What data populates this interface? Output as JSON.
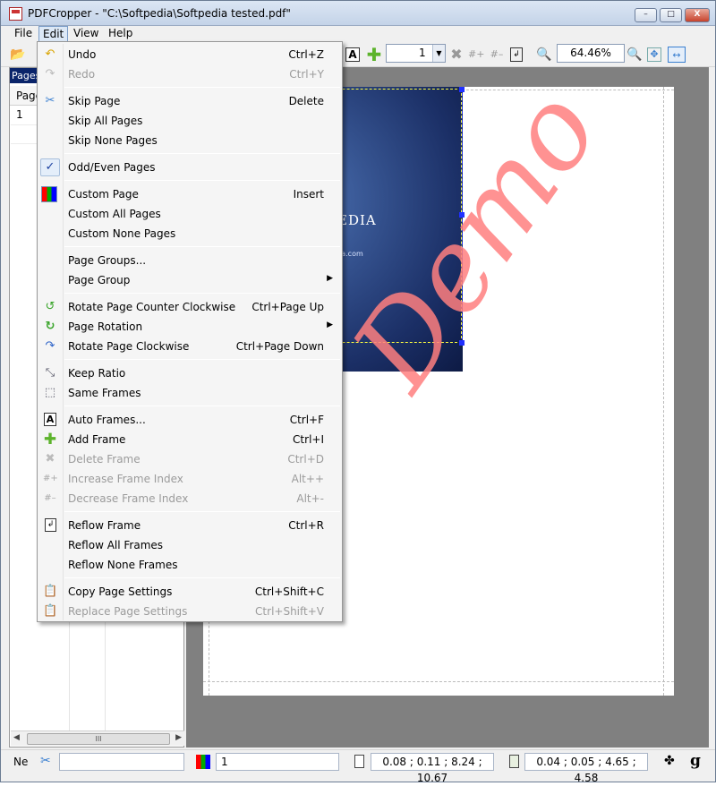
{
  "window": {
    "title": "PDFCropper - \"C:\\Softpedia\\Softpedia tested.pdf\"",
    "buttons": {
      "minimize": "–",
      "maximize": "□",
      "close": "X"
    }
  },
  "menubar": [
    "File",
    "Edit",
    "View",
    "Help"
  ],
  "toolbar": {
    "page_combo_value": "1",
    "zoom_value": "64.46%"
  },
  "left_panel": {
    "title": "Pages",
    "column_header": "Page",
    "rows": [
      "1"
    ],
    "scroll_thumb": "III"
  },
  "document": {
    "brand_text": "EDIA",
    "url_text": "ia.com",
    "watermark": "Demo"
  },
  "statusbar": {
    "left_label": "Ne",
    "page_field": "1",
    "page_box": "0.08 ; 0.11 ; 8.24 ; 10.67",
    "frame_box": "0.04 ; 0.05 ; 4.65 ; 4.58"
  },
  "edit_menu": {
    "undo": {
      "label": "Undo",
      "shortcut": "Ctrl+Z"
    },
    "redo": {
      "label": "Redo",
      "shortcut": "Ctrl+Y"
    },
    "skip_page": {
      "label": "Skip Page",
      "shortcut": "Delete"
    },
    "skip_all": {
      "label": "Skip All Pages"
    },
    "skip_none": {
      "label": "Skip None Pages"
    },
    "odd_even": {
      "label": "Odd/Even Pages"
    },
    "custom_page": {
      "label": "Custom Page",
      "shortcut": "Insert"
    },
    "custom_all": {
      "label": "Custom All Pages"
    },
    "custom_none": {
      "label": "Custom None Pages"
    },
    "page_groups": {
      "label": "Page Groups..."
    },
    "page_group": {
      "label": "Page Group",
      "arrow": "▶"
    },
    "rotate_ccw": {
      "label": "Rotate Page Counter Clockwise",
      "shortcut": "Ctrl+Page Up"
    },
    "page_rotation": {
      "label": "Page Rotation",
      "arrow": "▶"
    },
    "rotate_cw": {
      "label": "Rotate Page Clockwise",
      "shortcut": "Ctrl+Page Down"
    },
    "keep_ratio": {
      "label": "Keep Ratio"
    },
    "same_frames": {
      "label": "Same Frames"
    },
    "auto_frames": {
      "label": "Auto Frames...",
      "shortcut": "Ctrl+F"
    },
    "add_frame": {
      "label": "Add Frame",
      "shortcut": "Ctrl+I"
    },
    "delete_frame": {
      "label": "Delete Frame",
      "shortcut": "Ctrl+D"
    },
    "inc_frame_index": {
      "label": "Increase Frame Index",
      "shortcut": "Alt++"
    },
    "dec_frame_index": {
      "label": "Decrease Frame Index",
      "shortcut": "Alt+-"
    },
    "reflow_frame": {
      "label": "Reflow Frame",
      "shortcut": "Ctrl+R"
    },
    "reflow_all": {
      "label": "Reflow All Frames"
    },
    "reflow_none": {
      "label": "Reflow None Frames"
    },
    "copy_settings": {
      "label": "Copy Page Settings",
      "shortcut": "Ctrl+Shift+C"
    },
    "replace_settings": {
      "label": "Replace Page Settings",
      "shortcut": "Ctrl+Shift+V"
    }
  },
  "colors": {
    "accent": "#0a246a",
    "watermark": "#ff7f7f",
    "frame_handle": "#2030ff"
  }
}
